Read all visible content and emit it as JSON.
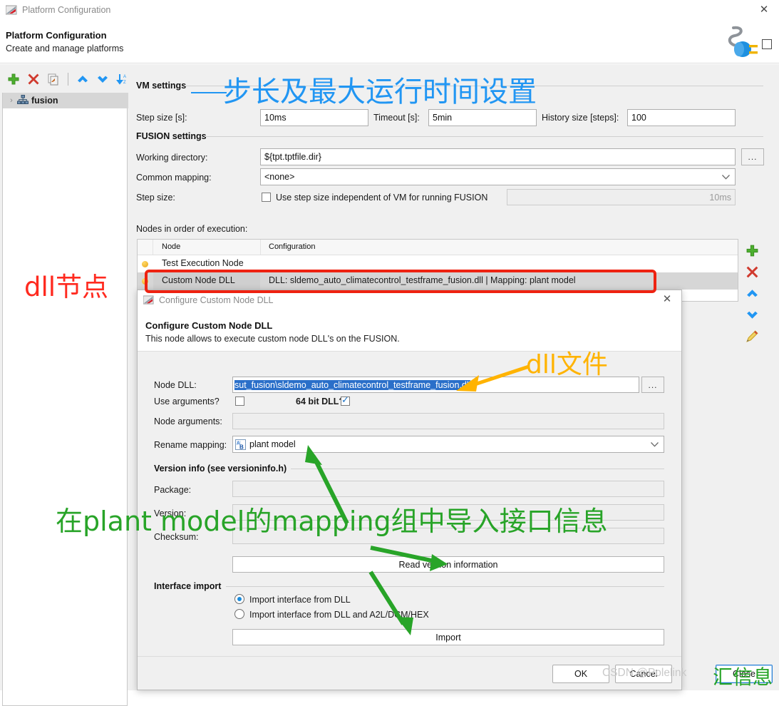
{
  "window": {
    "titlebar_title": "Platform Configuration",
    "titlebar_icon": "app-flag-icon",
    "close_glyph": "✕",
    "header_title": "Platform Configuration",
    "header_subtitle": "Create and manage platforms",
    "logo_icon": "plug-connector-icon"
  },
  "tree_toolbar": [
    {
      "name": "add-platform-button",
      "icon": "green-plus-icon",
      "glyph": "✚",
      "color": "#4caf2f"
    },
    {
      "name": "delete-platform-button",
      "icon": "red-x-icon",
      "glyph": "✖",
      "color": "#d03a2e"
    },
    {
      "name": "copy-platform-button",
      "icon": "copy-icon",
      "glyph": "⧉",
      "color": "#b06a30"
    },
    {
      "name": "move-up-button",
      "icon": "chevron-up-icon",
      "glyph": "⌃",
      "color": "#2196f3"
    },
    {
      "name": "move-down-button",
      "icon": "chevron-down-icon",
      "glyph": "⌄",
      "color": "#2196f3"
    },
    {
      "name": "sort-az-button",
      "icon": "sort-az-icon",
      "glyph": "⇩",
      "color": "#2196f3"
    }
  ],
  "tree": {
    "expander_glyph": "›",
    "node_icon": "platform-network-icon",
    "node_label": "fusion"
  },
  "vm_settings": {
    "group_label": "VM settings",
    "step_size_label": "Step size [s]:",
    "step_size_value": "10ms",
    "timeout_label": "Timeout [s]:",
    "timeout_value": "5min",
    "history_label": "History size [steps]:",
    "history_value": "100"
  },
  "fusion_settings": {
    "group_label": "FUSION settings",
    "working_dir_label": "Working directory:",
    "working_dir_value": "${tpt.tptfile.dir}",
    "browse_label": "...",
    "common_mapping_label": "Common mapping:",
    "common_mapping_value": "<none>",
    "step_size_label": "Step size:",
    "independent_step_checkbox_label": "Use step size independent of VM for running FUSION",
    "independent_step_checked": false,
    "independent_step_value": "10ms"
  },
  "nodes_section": {
    "label": "Nodes in order of execution:",
    "columns": [
      "Node",
      "Configuration"
    ],
    "rows": [
      {
        "bullet": "yellow-dot-icon",
        "node": "Test Execution Node",
        "configuration": "",
        "selected": false
      },
      {
        "bullet": "yellow-dot-icon",
        "node": "Custom Node DLL",
        "configuration": "DLL: sldemo_auto_climatecontrol_testframe_fusion.dll | Mapping: plant model",
        "selected": true
      }
    ],
    "side_buttons": [
      {
        "name": "add-node-button",
        "icon": "green-plus-icon",
        "glyph": "✚",
        "color": "#4caf2f"
      },
      {
        "name": "delete-node-button",
        "icon": "red-x-icon",
        "glyph": "✖",
        "color": "#d03a2e"
      },
      {
        "name": "move-node-up-button",
        "icon": "chevron-up-icon",
        "glyph": "⌃",
        "color": "#2196f3"
      },
      {
        "name": "move-node-down-button",
        "icon": "chevron-down-icon",
        "glyph": "⌄",
        "color": "#2196f3"
      },
      {
        "name": "edit-node-button",
        "icon": "pencil-edit-icon",
        "glyph": "✎",
        "color": "#e0b020"
      }
    ]
  },
  "close_button_label": "Close",
  "dialog": {
    "titlebar_title": "Configure Custom Node DLL",
    "titlebar_icon": "app-flag-icon",
    "close_glyph": "✕",
    "header_title": "Configure Custom Node DLL",
    "header_subtitle": "This node allows to execute custom node DLL's on the FUSION.",
    "node_dll_label": "Node DLL:",
    "node_dll_value": "sut_fusion\\sldemo_auto_climatecontrol_testframe_fusion.dll",
    "node_dll_browse_label": "...",
    "use_arguments_label": "Use arguments?",
    "use_arguments_checked": false,
    "bit64_label": "64 bit DLL?",
    "bit64_checked": true,
    "node_arguments_label": "Node arguments:",
    "node_arguments_value": "",
    "rename_mapping_label": "Rename mapping:",
    "rename_mapping_value": "plant model",
    "rename_mapping_icon": "mapping-ab-icon",
    "version_group_label": "Version info (see versioninfo.h)",
    "package_label": "Package:",
    "package_value": "",
    "version_label": "Version:",
    "version_value": "",
    "checksum_label": "Checksum:",
    "checksum_value": "",
    "read_version_button_label": "Read version information",
    "interface_group_label": "Interface import",
    "radio_dll_label": "Import interface from DLL",
    "radio_dll_selected": true,
    "radio_dll_a2l_label": "Import interface from DLL and A2L/DCM/HEX",
    "radio_dll_a2l_selected": false,
    "import_button_label": "Import",
    "ok_label": "OK",
    "cancel_label": "Cancel"
  },
  "annotations": {
    "blue_note": "步长及最大运行时间设置",
    "red_note": "dll节点",
    "orange_note": "dll文件",
    "green_note": "在plant model的mapping组中导入接口信息",
    "green_note_2": "汇信息",
    "colors": {
      "blue": "#2196f3",
      "red": "#ff2a1f",
      "orange": "#ffb300",
      "green": "#28a428",
      "highlight_box": "#ee2211"
    }
  },
  "watermark": "CSDN @Polelink"
}
